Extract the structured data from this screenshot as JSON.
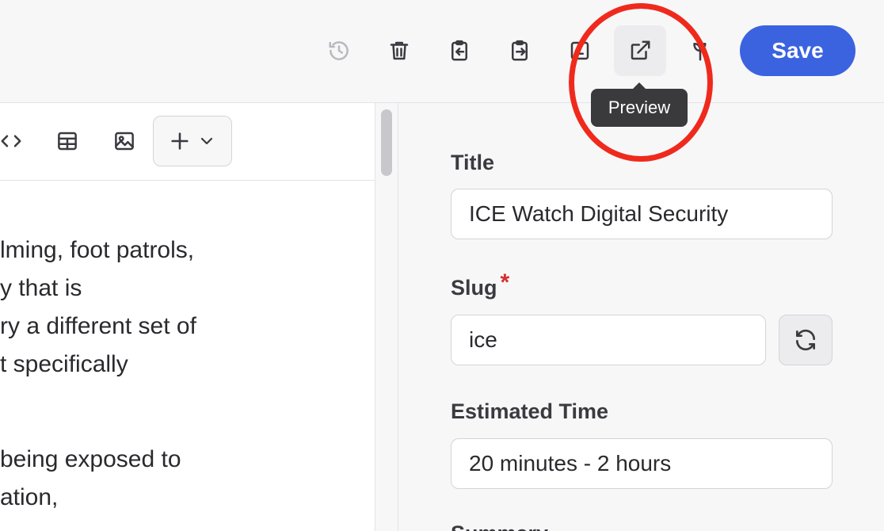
{
  "toolbar": {
    "icons": [
      "history-icon",
      "trash-icon",
      "clipboard-import-icon",
      "clipboard-export-icon",
      "save-draft-icon",
      "external-link-icon",
      "plant-icon"
    ],
    "save_label": "Save",
    "tooltip": "Preview"
  },
  "editor": {
    "tools": [
      "code-icon",
      "table-icon",
      "image-icon",
      "plus-icon",
      "chevron-down-icon"
    ],
    "lines": [
      "lming, foot patrols,",
      "y that is",
      "ry a different set of",
      "t specifically",
      "",
      " being exposed to",
      "ation,"
    ]
  },
  "settings": {
    "title_label": "Title",
    "title_value": "ICE Watch Digital Security",
    "slug_label": "Slug",
    "slug_required": "*",
    "slug_value": "ice",
    "time_label": "Estimated Time",
    "time_value": "20 minutes - 2 hours",
    "summary_label": "Summary"
  },
  "colors": {
    "accent": "#3b63e0",
    "annotation": "#ef2a1c",
    "required": "#d32f2f"
  }
}
